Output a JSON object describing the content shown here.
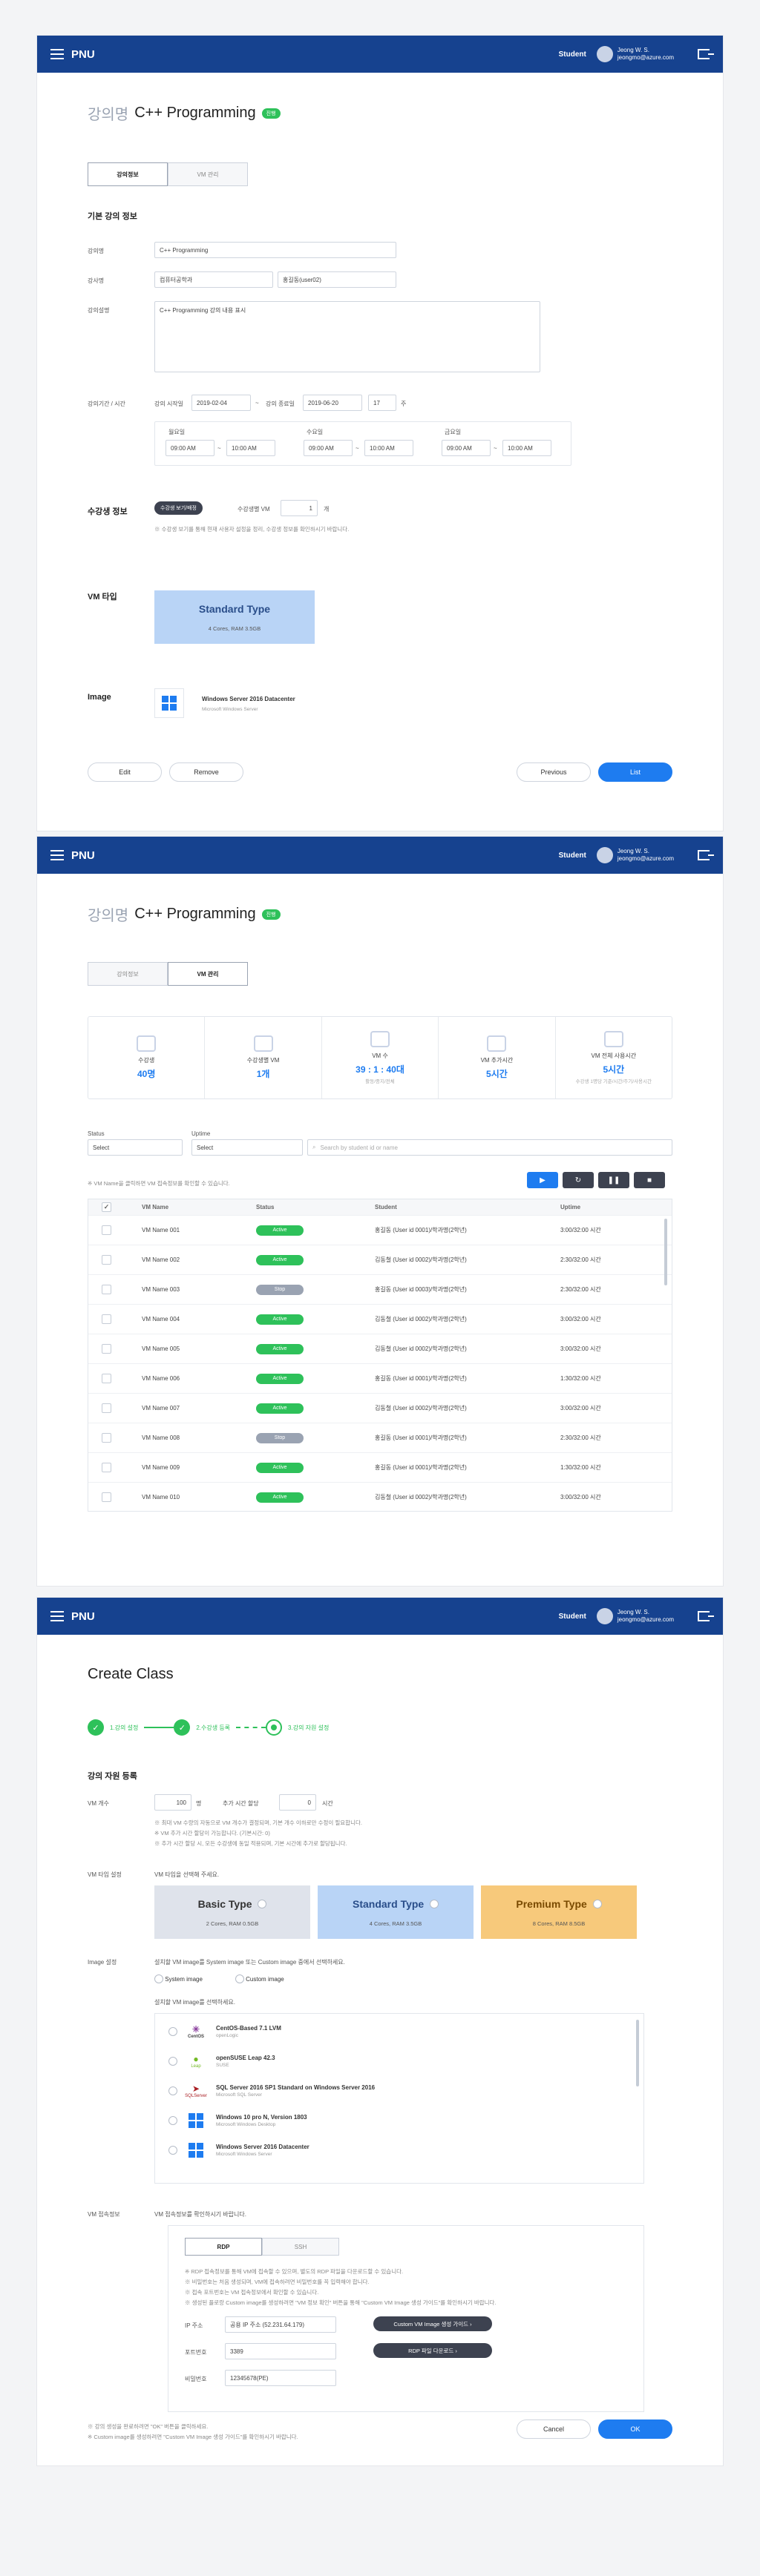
{
  "header": {
    "logo": "PNU",
    "role": "Student",
    "user_name": "Jeong W. S.",
    "user_email": "jeongmo@azure.com"
  },
  "course": {
    "prefix": "강의명",
    "title": "C++ Programming",
    "badge": "진행"
  },
  "tabs": [
    "강의정보",
    "VM 관리"
  ],
  "info": {
    "section_basic": "기본 강의 정보",
    "label_course_name": "강의명",
    "course_name": "C++ Programming",
    "label_instructor": "강사명",
    "dept": "컴퓨터공학과",
    "instructor": "홍길동(user02)",
    "label_desc": "강의설명",
    "desc": "C++ Programming 강의 내용 표시",
    "label_period": "강의기간 / 시간",
    "start_label": "강의 시작일",
    "start_date": "2019-02-04",
    "tilde": "~",
    "end_label": "강의 종료일",
    "end_date": "2019-06-20",
    "weeks": "17",
    "weeks_unit": "주",
    "days": [
      {
        "day": "월요일",
        "from": "09:00 AM",
        "to": "10:00 AM"
      },
      {
        "day": "수요일",
        "from": "09:00 AM",
        "to": "10:00 AM"
      },
      {
        "day": "금요일",
        "from": "09:00 AM",
        "to": "10:00 AM"
      }
    ],
    "section_students": "수강생 정보",
    "student_btn": "수강생 보기/배정",
    "label_vm_per": "수강생별 VM",
    "vm_per": "1",
    "vm_per_unit": "개",
    "student_note": "※ 수강생 보기를 통해 현재 사용자 설정을 정리, 수강생 정보를 확인하시기 바랍니다.",
    "section_vm": "VM 타입",
    "vm_type": "Standard Type",
    "vm_spec": "4 Cores, RAM 3.5GB",
    "section_image": "Image",
    "image_name": "Windows Server 2016 Datacenter",
    "image_vendor": "Microsoft Windows Server",
    "btn_edit": "Edit",
    "btn_remove": "Remove",
    "btn_previous": "Previous",
    "btn_list": "List"
  },
  "vm": {
    "stats": [
      {
        "label": "수강생",
        "value": "40명",
        "sub": ""
      },
      {
        "label": "수강생별 VM",
        "value": "1개",
        "sub": ""
      },
      {
        "label": "VM 수",
        "value": "39 : 1 : 40대",
        "sub": "활동/중지/전체"
      },
      {
        "label": "VM 추가시간",
        "value": "5시간",
        "sub": ""
      },
      {
        "label": "VM 전체 사용시간",
        "value": "5시간",
        "sub": "수강생 1명당 기준/시간/주기/사용시간"
      }
    ],
    "filter_status_label": "Status",
    "filter_status": "Select",
    "filter_uptime_label": "Uptime",
    "filter_uptime": "Select",
    "search_placeholder": "Search by student id or name",
    "select_note": "※ VM Name을 클릭하면 VM 접속정보를 확인할 수 있습니다.",
    "columns": [
      "VM Name",
      "Status",
      "Student",
      "Uptime"
    ],
    "rows": [
      {
        "name": "VM Name 001",
        "status": "Active",
        "student": "홍길동 (User id 0001)/학과명(2학년)",
        "uptime": "3:00/32:00 시간"
      },
      {
        "name": "VM Name 002",
        "status": "Active",
        "student": "김동철 (User id 0002)/학과명(2학년)",
        "uptime": "2:30/32:00 시간"
      },
      {
        "name": "VM Name 003",
        "status": "Stop",
        "student": "홍길동 (User id 0003)/학과명(2학년)",
        "uptime": "2:30/32:00 시간"
      },
      {
        "name": "VM Name 004",
        "status": "Active",
        "student": "김동철 (User id 0002)/학과명(2학년)",
        "uptime": "3:00/32:00 시간"
      },
      {
        "name": "VM Name 005",
        "status": "Active",
        "student": "김동철 (User id 0002)/학과명(2학년)",
        "uptime": "3:00/32:00 시간"
      },
      {
        "name": "VM Name 006",
        "status": "Active",
        "student": "홍길동 (User id 0001)/학과명(2학년)",
        "uptime": "1:30/32:00 시간"
      },
      {
        "name": "VM Name 007",
        "status": "Active",
        "student": "김동철 (User id 0002)/학과명(2학년)",
        "uptime": "3:00/32:00 시간"
      },
      {
        "name": "VM Name 008",
        "status": "Stop",
        "student": "홍길동 (User id 0001)/학과명(2학년)",
        "uptime": "2:30/32:00 시간"
      },
      {
        "name": "VM Name 009",
        "status": "Active",
        "student": "홍길동 (User id 0001)/학과명(2학년)",
        "uptime": "1:30/32:00 시간"
      },
      {
        "name": "VM Name 010",
        "status": "Active",
        "student": "김동철 (User id 0002)/학과명(2학년)",
        "uptime": "3:00/32:00 시간"
      }
    ]
  },
  "create": {
    "title": "Create Class",
    "steps": [
      "1.강의 설정",
      "2.수강생 등록",
      "3.강의 자원 설정"
    ],
    "section": "강의 자원 등록",
    "label_vm_count": "VM 개수",
    "vm_count": "100",
    "vm_count_unit": "명",
    "label_extra": "추가 시간 할당",
    "extra": "0",
    "extra_unit": "시간",
    "notes": [
      "※ 최대 VM 수량의 자동으로 VM 개수가 결정되며, 기본 개수 이하로만 수정이 필요합니다.",
      "※ VM 추가 시간 할당이 가능합니다. (기본시간: 0)",
      "※ 추가 시간 할당 시, 모든 수강생에 동일 적용되며, 기본 시간에 추가로 할당됩니다."
    ],
    "label_vm_type": "VM 타입 설정",
    "vm_type_hint": "VM 타입을 선택해 주세요.",
    "vm_types": [
      {
        "name": "Basic Type",
        "spec": "2 Cores, RAM 0.5GB",
        "color": "#dfe3eb"
      },
      {
        "name": "Standard Type",
        "spec": "4 Cores, RAM 3.5GB",
        "color": "#b9d4f6"
      },
      {
        "name": "Premium Type",
        "spec": "8 Cores, RAM 8.5GB",
        "color": "#f7c97b"
      }
    ],
    "label_image": "Image 설정",
    "image_hint": "설치할 VM image를 System image 또는 Custom image 중에서 선택하세요.",
    "radio_system": "System image",
    "radio_custom": "Custom image",
    "image_hint2": "설치할 VM image를 선택하세요.",
    "images": [
      {
        "name": "CentOS-Based 7.1 LVM",
        "vendor": "openLogic",
        "icon": "centos-logo"
      },
      {
        "name": "openSUSE Leap 42.3",
        "vendor": "SUSE",
        "icon": "suse-logo"
      },
      {
        "name": "SQL Server 2016 SP1 Standard on Windows Server 2016",
        "vendor": "Microsoft SQL Server",
        "icon": "sql-server-logo"
      },
      {
        "name": "Windows 10 pro N, Version 1803",
        "vendor": "Microsoft Windows Desktop",
        "icon": "windows-logo"
      },
      {
        "name": "Windows Server 2016 Datacenter",
        "vendor": "Microsoft Windows Server",
        "icon": "windows-logo"
      }
    ],
    "label_access": "VM 접속정보",
    "access_hint": "VM 접속정보를 확인하시기 바랍니다.",
    "access_tabs": [
      "RDP",
      "SSH"
    ],
    "access_notes": [
      "※ RDP 접속정보를 통해 VM에 접속할 수 있으며, 별도의 RDP 파일을 다운로드할 수 있습니다.",
      "※ 비밀번호는 처음 생성되며, VM에 접속하려면 비밀번호를 꼭 입력해야 합니다.",
      "※ 접속 포트번호는 VM 접속정보에서 확인할 수 있습니다.",
      "※ 생성된 플로랑 Custom image를 생성하려면 \"VM 정보 확인\" 버튼을 통해 \"Custom VM Image 생성 가이드\"를 확인하시기 바랍니다."
    ],
    "label_ip": "IP 주소",
    "ip": "공용 IP 주소 (52.231.64.179)",
    "label_port": "포트번호",
    "port": "3389",
    "label_pw": "비밀번호",
    "pw": "12345678(PE)",
    "btn_guide": "Custom VM Image 생성 가이드 ›",
    "btn_rdp": "RDP 파일 다운로드 ›",
    "foot_notes": [
      "※ 강의 생성을 완료하려면 \"OK\" 버튼을 클릭하세요.",
      "※ Custom image를 생성하려면 \"Custom VM Image 생성 가이드\"를 확인하시기 바랍니다."
    ],
    "btn_cancel": "Cancel",
    "btn_ok": "OK"
  }
}
